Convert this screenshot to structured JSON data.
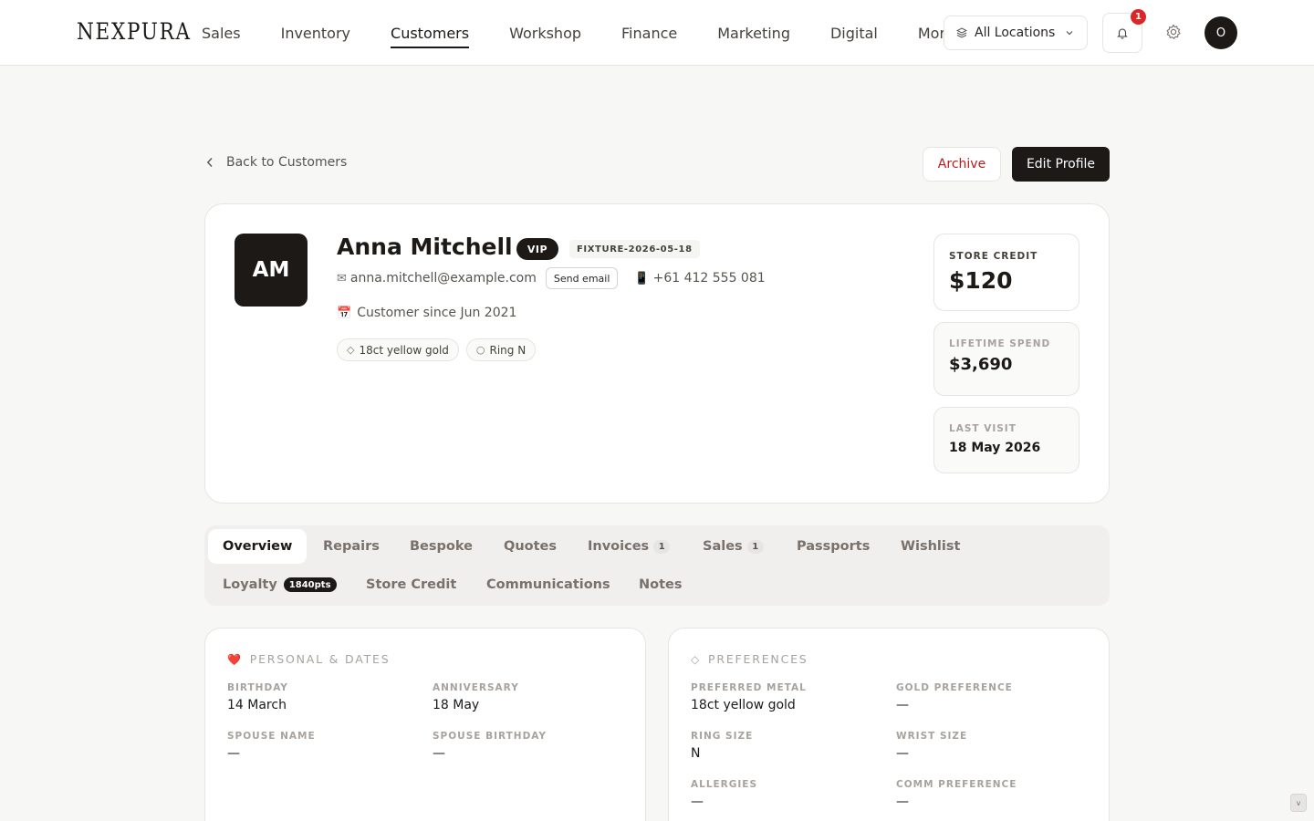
{
  "brand": {
    "logo": "NEXPURA"
  },
  "nav": {
    "items": [
      "Sales",
      "Inventory",
      "Customers",
      "Workshop",
      "Finance",
      "Marketing",
      "Digital",
      "More"
    ],
    "active": "Customers",
    "location_label": "All Locations",
    "notification_count": "1",
    "user_initial": "O"
  },
  "header": {
    "back_label": "Back to Customers",
    "archive_label": "Archive",
    "edit_label": "Edit Profile"
  },
  "customer": {
    "initials": "AM",
    "name": "Anna Mitchell",
    "vip_badge": "VIP",
    "fixture_tag": "FIXTURE-2026-05-18",
    "email": "anna.mitchell@example.com",
    "send_email_label": "Send email",
    "phone": "+61 412 555 081",
    "since": "Customer since Jun 2021",
    "chips": [
      {
        "icon": "gem-icon",
        "label": "18ct yellow gold"
      },
      {
        "icon": "ring-icon",
        "label": "Ring N"
      }
    ]
  },
  "stats": {
    "store_credit": {
      "label": "STORE CREDIT",
      "value": "$120"
    },
    "lifetime_spend": {
      "label": "LIFETIME SPEND",
      "value": "$3,690"
    },
    "last_visit": {
      "label": "LAST VISIT",
      "value": "18 May 2026"
    }
  },
  "tabs": [
    {
      "label": "Overview",
      "active": true
    },
    {
      "label": "Repairs"
    },
    {
      "label": "Bespoke"
    },
    {
      "label": "Quotes"
    },
    {
      "label": "Invoices",
      "count": "1"
    },
    {
      "label": "Sales",
      "count": "1"
    },
    {
      "label": "Passports"
    },
    {
      "label": "Wishlist"
    },
    {
      "label": "Loyalty",
      "points": "1840pts"
    },
    {
      "label": "Store Credit"
    },
    {
      "label": "Communications"
    },
    {
      "label": "Notes"
    }
  ],
  "personal": {
    "title": "PERSONAL & DATES",
    "fields": [
      {
        "label": "BIRTHDAY",
        "value": "14 March"
      },
      {
        "label": "ANNIVERSARY",
        "value": "18 May"
      },
      {
        "label": "SPOUSE NAME",
        "value": "—"
      },
      {
        "label": "SPOUSE BIRTHDAY",
        "value": "—"
      }
    ]
  },
  "preferences": {
    "title": "PREFERENCES",
    "fields": [
      {
        "label": "PREFERRED METAL",
        "value": "18ct yellow gold"
      },
      {
        "label": "GOLD PREFERENCE",
        "value": "—"
      },
      {
        "label": "RING SIZE",
        "value": "N"
      },
      {
        "label": "WRIST SIZE",
        "value": "—"
      },
      {
        "label": "ALLERGIES",
        "value": "—"
      },
      {
        "label": "COMM PREFERENCE",
        "value": "—"
      }
    ]
  },
  "colors": {
    "brand_dark": "#1c1917",
    "danger": "#b91c1c",
    "badge_red": "#dc2626",
    "page_bg": "#f7f7f5"
  },
  "corner_button_label": "v"
}
